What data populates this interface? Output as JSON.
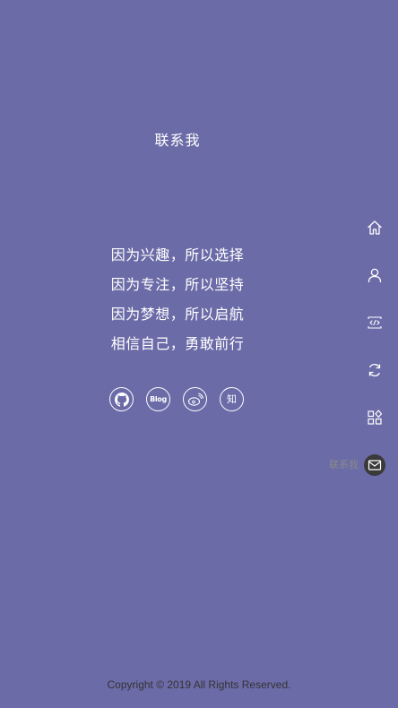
{
  "page": {
    "title": "联系我"
  },
  "slogans": [
    "因为兴趣，所以选择",
    "因为专注，所以坚持",
    "因为梦想，所以启航",
    "相信自己，勇敢前行"
  ],
  "socials": {
    "github": {
      "icon": "github-icon"
    },
    "blog": {
      "icon": "blog-icon",
      "label": "Blog"
    },
    "weibo": {
      "icon": "weibo-icon"
    },
    "zhihu": {
      "icon": "zhihu-icon",
      "label": "知"
    }
  },
  "side_nav": {
    "items": [
      {
        "icon": "home-icon"
      },
      {
        "icon": "user-icon"
      },
      {
        "icon": "code-icon"
      },
      {
        "icon": "refresh-icon"
      },
      {
        "icon": "apps-icon"
      },
      {
        "icon": "mail-icon",
        "label": "联系我",
        "active": true
      }
    ]
  },
  "footer": {
    "copyright": "Copyright © 2019 All Rights Reserved."
  },
  "colors": {
    "background": "#6b6ba8",
    "active_nav_bg": "#3a3a3a",
    "footer_text": "#333333"
  }
}
